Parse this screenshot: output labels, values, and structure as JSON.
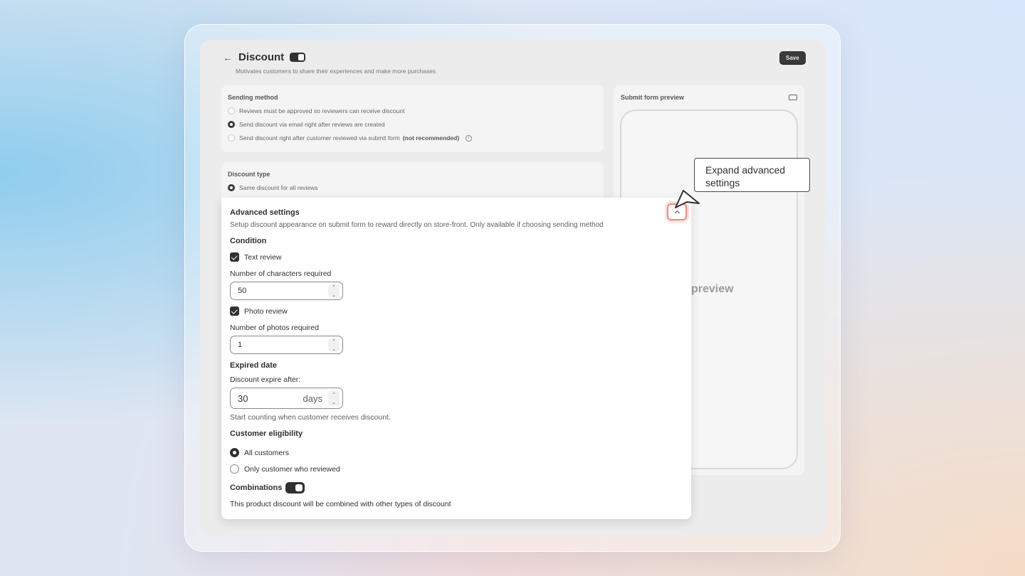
{
  "header": {
    "back_icon": "arrow-left-icon",
    "title": "Discount",
    "subtitle": "Motivates customers to share their experiences and make more purchases",
    "save_label": "Save"
  },
  "sending_method": {
    "title": "Sending method",
    "options": [
      {
        "label": "Reviews must be approved so reviewers can receive discount",
        "selected": false
      },
      {
        "label": "Send discount via email right after reviews are created",
        "selected": true
      },
      {
        "label": "Send discount right after customer reviewed via submit form",
        "suffix": "(not recommended)",
        "selected": false
      }
    ]
  },
  "discount_type": {
    "title": "Discount type",
    "options": [
      {
        "label": "Same discount for all reviews",
        "selected": true
      }
    ]
  },
  "preview": {
    "title": "Submit form preview",
    "device_icon": "desktop-icon",
    "placeholder": "preview"
  },
  "advanced": {
    "title": "Advanced settings",
    "subtitle": "Setup discount appearance on submit form to reward directly on store-front. Only available if choosing sending method",
    "condition_title": "Condition",
    "text_review_label": "Text review",
    "text_review_checked": true,
    "characters_label": "Number of characters required",
    "characters_value": "50",
    "photo_review_label": "Photo review",
    "photo_review_checked": true,
    "photos_label": "Number of photos required",
    "photos_value": "1",
    "expired_title": "Expired date",
    "expire_label": "Discount expire after:",
    "expire_value": "30",
    "expire_suffix": "days",
    "expire_help": "Start counting when customer receives discount.",
    "eligibility_title": "Customer eligibility",
    "eligibility_options": [
      {
        "label": "All customers",
        "selected": true
      },
      {
        "label": "Only customer who reviewed",
        "selected": false
      }
    ],
    "combinations_title": "Combinations",
    "combinations_help": "This product discount will be combined with other types of discount"
  },
  "tooltip": {
    "text": "Expand advanced settings"
  },
  "colors": {
    "accent": "#303030",
    "highlight": "#f4877d"
  }
}
